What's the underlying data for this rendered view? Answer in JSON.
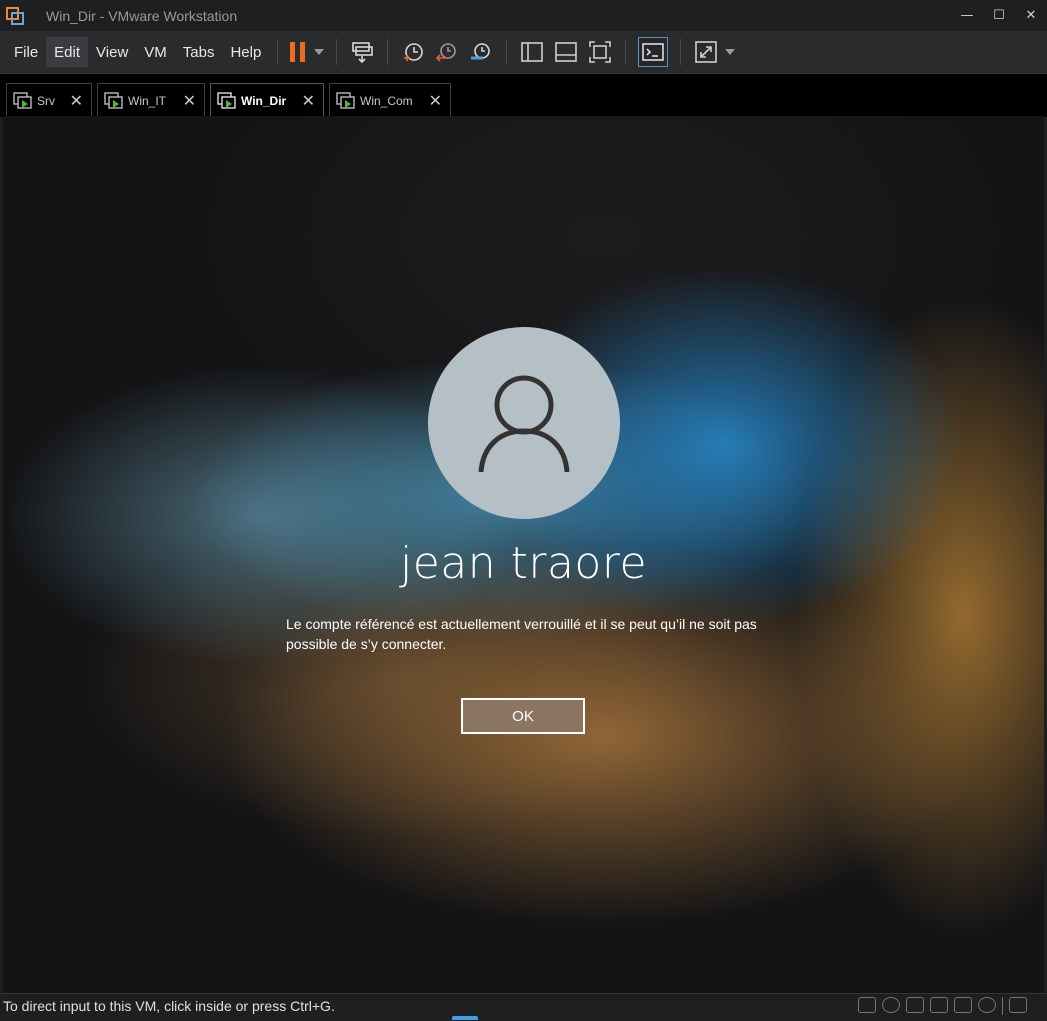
{
  "window": {
    "title": "Win_Dir - VMware Workstation",
    "controls": {
      "minimize": "—",
      "maximize": "☐",
      "close": "✕"
    }
  },
  "menu": {
    "items": [
      {
        "id": "file",
        "label": "File"
      },
      {
        "id": "edit",
        "label": "Edit"
      },
      {
        "id": "view",
        "label": "View"
      },
      {
        "id": "vm",
        "label": "VM"
      },
      {
        "id": "tabs",
        "label": "Tabs"
      },
      {
        "id": "help",
        "label": "Help"
      }
    ]
  },
  "toolbar": {
    "icons": [
      "pause-icon",
      "dropdown-icon",
      "send-ctrl-alt-del-icon",
      "snapshot-icon",
      "revert-snapshot-icon",
      "snapshot-manager-icon",
      "show-library-icon",
      "thumbnail-bar-icon",
      "full-screen-icon",
      "console-view-icon",
      "stretch-guest-icon",
      "dropdown-icon"
    ],
    "accent_pause": "#f06a21"
  },
  "tabs": [
    {
      "label": "Srv",
      "active": false
    },
    {
      "label": "Win_IT",
      "active": false
    },
    {
      "label": "Win_Dir",
      "active": true
    },
    {
      "label": "Win_Com",
      "active": false
    }
  ],
  "vm": {
    "username": "jean traore",
    "message": "Le compte référencé est actuellement verrouillé et il se peut qu’il ne soit pas possible de s’y connecter.",
    "ok_label": "OK",
    "ok_color": "#8c7560"
  },
  "statusbar": {
    "text": "To direct input to this VM, click inside or press Ctrl+G."
  }
}
